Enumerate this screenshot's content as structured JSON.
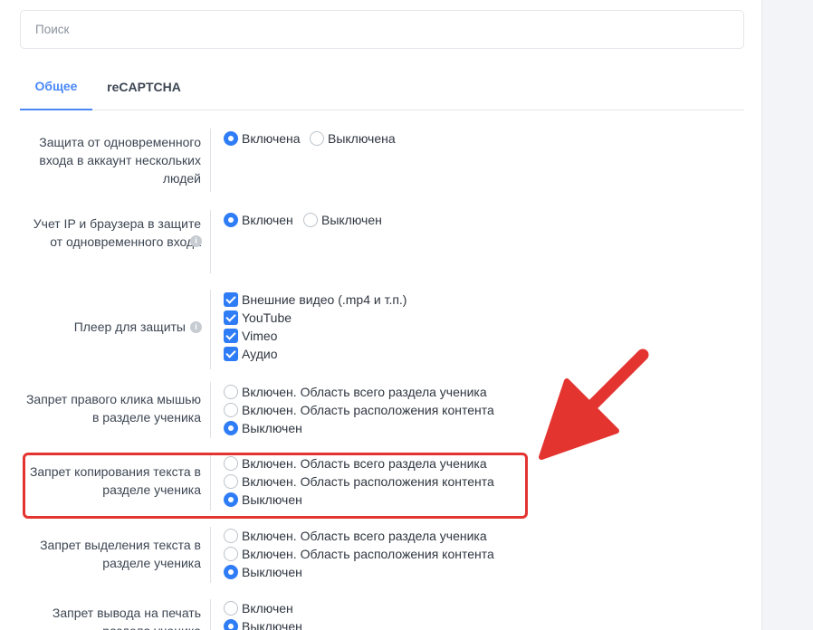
{
  "search": {
    "placeholder": "Поиск"
  },
  "tabs": [
    {
      "label": "Общее",
      "active": true
    },
    {
      "label": "reCAPTCHA",
      "active": false
    }
  ],
  "settings": [
    {
      "label": "Защита от одновременного входа в аккаунт нескольких людей",
      "options": [
        {
          "label": "Включена",
          "selected": true
        },
        {
          "label": "Выключена",
          "selected": false
        }
      ]
    },
    {
      "label": "Учет IP и браузера в защите от одновременного входа",
      "options": [
        {
          "label": "Включен",
          "selected": true
        },
        {
          "label": "Выключен",
          "selected": false
        }
      ]
    },
    {
      "label": "Плеер для защиты",
      "options": [
        {
          "label": "Внешние видео (.mp4 и т.п.)",
          "checked": true
        },
        {
          "label": "YouTube",
          "checked": true
        },
        {
          "label": "Vimeo",
          "checked": true
        },
        {
          "label": "Аудио",
          "checked": true
        }
      ]
    },
    {
      "label": "Запрет правого клика мышью в разделе ученика",
      "options": [
        {
          "label": "Включен. Область всего раздела ученика",
          "selected": false
        },
        {
          "label": "Включен. Область расположения контента",
          "selected": false
        },
        {
          "label": "Выключен",
          "selected": true
        }
      ]
    },
    {
      "label": "Запрет копирования текста в разделе ученика",
      "options": [
        {
          "label": "Включен. Область всего раздела ученика",
          "selected": false
        },
        {
          "label": "Включен. Область расположения контента",
          "selected": false
        },
        {
          "label": "Выключен",
          "selected": true
        }
      ]
    },
    {
      "label": "Запрет выделения текста в разделе ученика",
      "options": [
        {
          "label": "Включен. Область всего раздела ученика",
          "selected": false
        },
        {
          "label": "Включен. Область расположения контента",
          "selected": false
        },
        {
          "label": "Выключен",
          "selected": true
        }
      ]
    },
    {
      "label": "Запрет вывода на печать раздела ученика",
      "options": [
        {
          "label": "Включен",
          "selected": false
        },
        {
          "label": "Выключен",
          "selected": true
        }
      ]
    }
  ],
  "colors": {
    "accent": "#2f7df6",
    "tab_active": "#4a88f7",
    "highlight": "#e3342f"
  },
  "icons": {
    "info": "info-icon",
    "annotation_arrow": "red-arrow-icon"
  }
}
